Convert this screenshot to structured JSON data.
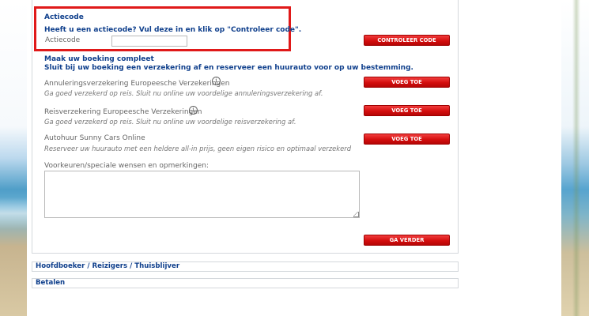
{
  "promo": {
    "title": "Actiecode",
    "prompt": "Heeft u een actiecode? Vul deze in en klik op \"Controleer code\".",
    "field_label": "Actiecode",
    "field_value": "",
    "check_button": "CONTROLEER CODE"
  },
  "booking": {
    "title": "Maak uw boeking compleet",
    "subtitle": "Sluit bij uw boeking een verzekering af en reserveer een huurauto voor op uw bestemming.",
    "options": [
      {
        "label": "Annuleringsverzekering Europeesche Verzekeringen",
        "description": "Ga goed verzekerd op reis. Sluit nu online uw voordelige annuleringsverzekering af.",
        "button": "VOEG TOE",
        "has_info": true
      },
      {
        "label": "Reisverzekering Europeesche Verzekeringen",
        "description": "Ga goed verzekerd op reis. Sluit nu online uw voordelige reisverzekering af.",
        "button": "VOEG TOE",
        "has_info": true
      },
      {
        "label": "Autohuur Sunny Cars Online",
        "description": "Reserveer uw huurauto met een heldere all-in prijs, geen eigen risico en optimaal verzekerd",
        "button": "VOEG TOE",
        "has_info": false
      }
    ],
    "preferences_label": "Voorkeuren/speciale wensen en opmerkingen:",
    "preferences_value": "",
    "continue_button": "GA VERDER"
  },
  "sections": {
    "travelers": "Hoofdboeker / Reizigers / Thuisblijver",
    "payment": "Betalen"
  },
  "icons": {
    "info": "info-icon",
    "info_glyph": "i"
  },
  "colors": {
    "heading": "#0f3f8c",
    "button": "#d40e0e",
    "highlight_border": "#e01919"
  }
}
